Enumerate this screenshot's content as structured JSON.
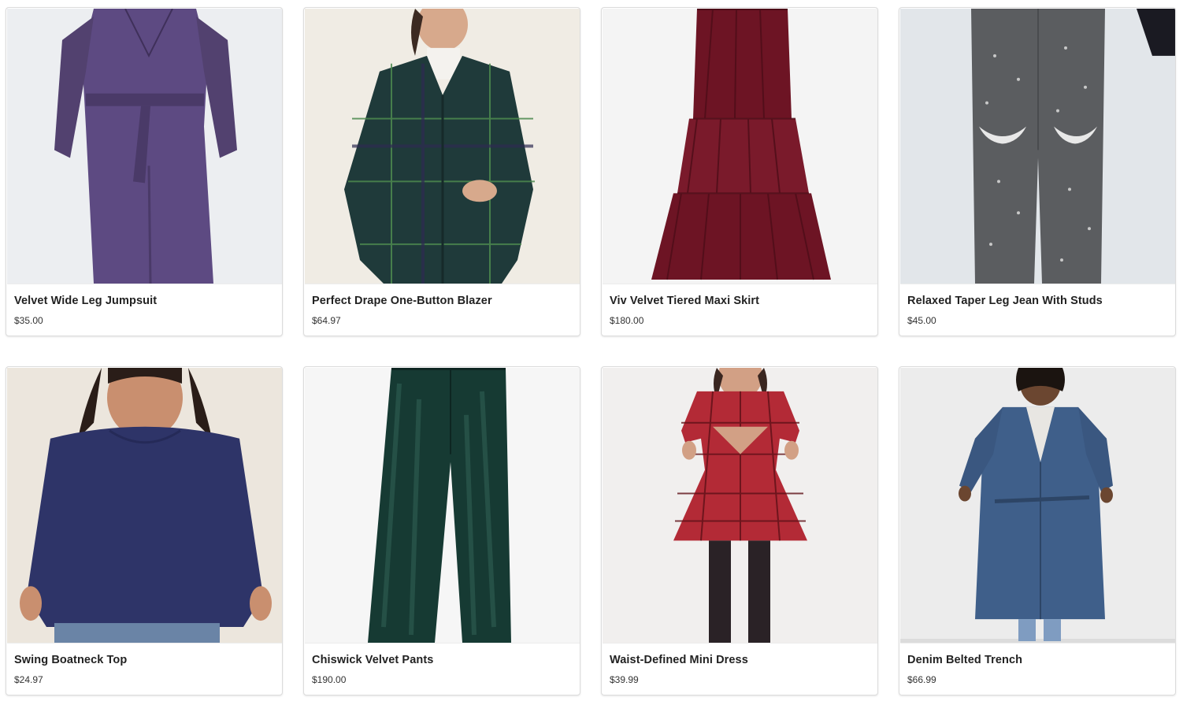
{
  "products": [
    {
      "name": "Velvet Wide Leg Jumpsuit",
      "price": "$35.00",
      "image": "purple-velvet-jumpsuit",
      "bg": "#eceef1",
      "color": "#5d4a82"
    },
    {
      "name": "Perfect Drape One-Button Blazer",
      "price": "$64.97",
      "image": "green-plaid-blazer",
      "bg": "#f0ece4",
      "color": "#1f3a3a"
    },
    {
      "name": "Viv Velvet Tiered Maxi Skirt",
      "price": "$180.00",
      "image": "burgundy-tiered-maxi-skirt",
      "bg": "#f4f4f4",
      "color": "#6d1424"
    },
    {
      "name": "Relaxed Taper Leg Jean With Studs",
      "price": "$45.00",
      "image": "grey-studded-jeans",
      "bg": "#e2e6ea",
      "color": "#5b5d60"
    },
    {
      "name": "Swing Boatneck Top",
      "price": "$24.97",
      "image": "navy-boatneck-top",
      "bg": "#ece6dd",
      "color": "#2e3468"
    },
    {
      "name": "Chiswick Velvet Pants",
      "price": "$190.00",
      "image": "green-velvet-pants",
      "bg": "#f6f6f6",
      "color": "#163a33"
    },
    {
      "name": "Waist-Defined Mini Dress",
      "price": "$39.99",
      "image": "red-plaid-mini-dress",
      "bg": "#f1efee",
      "color": "#b32a36"
    },
    {
      "name": "Denim Belted Trench",
      "price": "$66.99",
      "image": "denim-belted-trench",
      "bg": "#ececec",
      "color": "#3f5f8a"
    }
  ]
}
